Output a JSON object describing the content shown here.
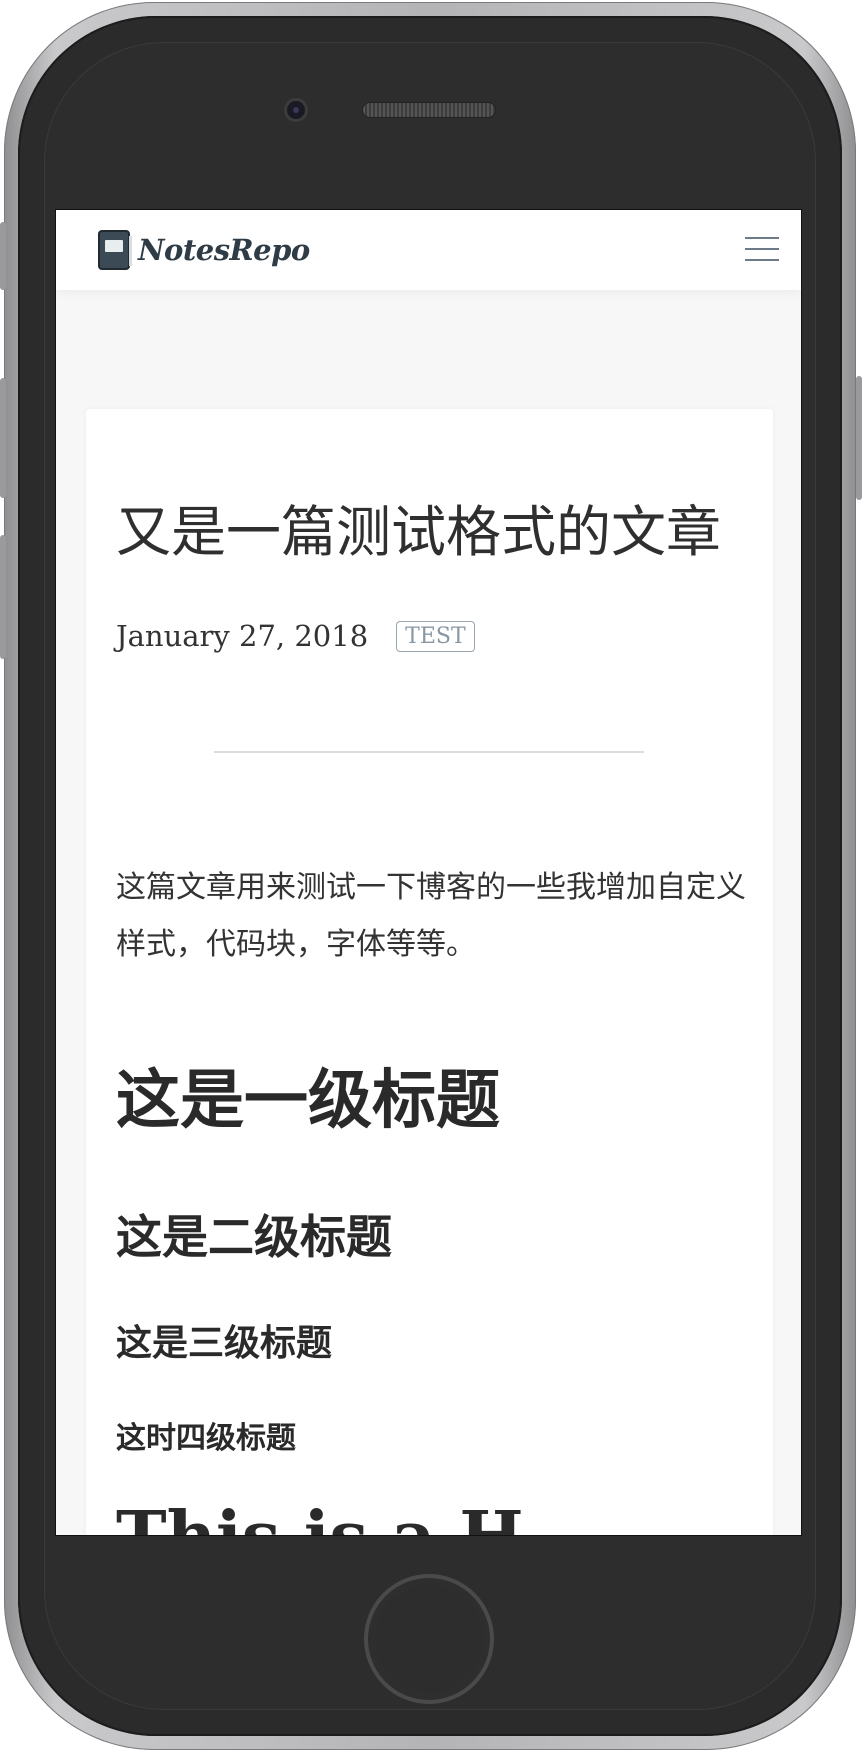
{
  "navbar": {
    "brand_name": "NotesRepo",
    "brand_icon": "notebook-icon",
    "menu_icon": "hamburger-menu-icon"
  },
  "post": {
    "title": "又是一篇测试格式的文章",
    "date": "January 27, 2018",
    "tag": "TEST",
    "intro": "这篇文章用来测试一下博客的一些我增加自定义样式，代码块，字体等等。",
    "heading_1": "这是一级标题",
    "heading_2": "这是二级标题",
    "heading_3": "这是三级标题",
    "heading_4": "这时四级标题",
    "heading_en": "This is a H"
  },
  "colors": {
    "page_background": "#f7f7f7",
    "card_background": "#ffffff",
    "text": "#333333",
    "tag_border": "#9aa6b0",
    "phone_body": "#2b2b2b"
  }
}
